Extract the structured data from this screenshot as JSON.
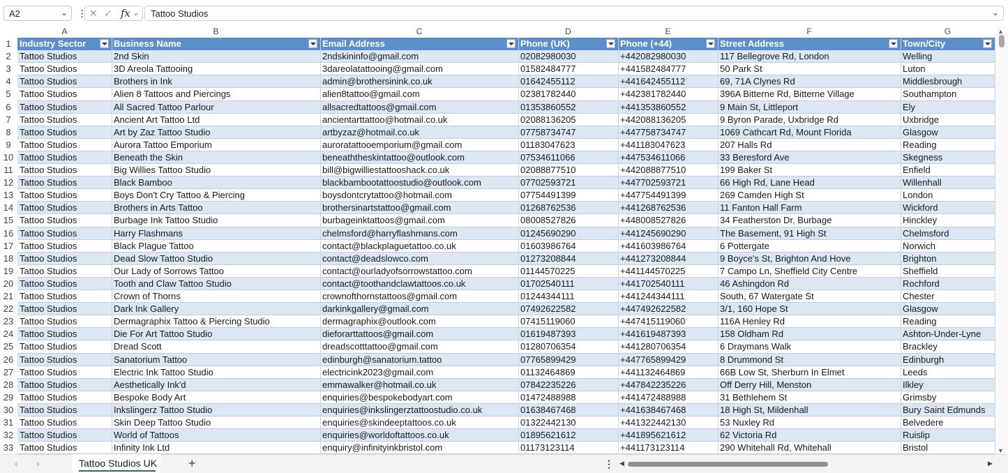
{
  "formula_bar": {
    "name_box": "A2",
    "fx": "fx",
    "content": "Tattoo Studios"
  },
  "columns": [
    "A",
    "B",
    "C",
    "D",
    "E",
    "F",
    "G"
  ],
  "headers": [
    "Industry Sector",
    "Business Name",
    "Email Address",
    "Phone (UK)",
    "Phone (+44)",
    "Street Address",
    "Town/City"
  ],
  "rows": [
    [
      "2",
      "Tattoo Studios",
      "2nd Skin",
      "2ndskininfo@gmail.com",
      "02082980030",
      "+442082980030",
      "117 Bellegrove Rd, London",
      "Welling"
    ],
    [
      "3",
      "Tattoo Studios",
      "3D Areola Tattooing",
      "3dareolatattooing@gmail.com",
      "01582484777",
      "+441582484777",
      "50 Park St",
      "Luton"
    ],
    [
      "4",
      "Tattoo Studios",
      "Brothers in Ink",
      "admin@brothersinink.co.uk",
      "01642455112",
      "+441642455112",
      "69, 71A Clynes Rd",
      "Middlesbrough"
    ],
    [
      "5",
      "Tattoo Studios",
      "Alien 8 Tattoos and Piercings",
      "alien8tattoo@gmail.com",
      "02381782440",
      "+442381782440",
      "396A Bitterne Rd, Bitterne Village",
      "Southampton"
    ],
    [
      "6",
      "Tattoo Studios",
      "All Sacred Tattoo Parlour",
      "allsacredtattoos@gmail.com",
      "01353860552",
      "+441353860552",
      "9 Main St, Littleport",
      "Ely"
    ],
    [
      "7",
      "Tattoo Studios",
      "Ancient Art Tattoo Ltd",
      "ancientarttattoo@hotmail.co.uk",
      "02088136205",
      "+442088136205",
      "9 Byron Parade, Uxbridge Rd",
      "Uxbridge"
    ],
    [
      "8",
      "Tattoo Studios",
      "Art by Zaz Tattoo Studio",
      "artbyzaz@hotmail.co.uk",
      "07758734747",
      "+447758734747",
      "1069 Cathcart Rd, Mount Florida",
      "Glasgow"
    ],
    [
      "9",
      "Tattoo Studios",
      "Aurora Tattoo Emporium",
      "auroratattooemporium@gmail.com",
      "01183047623",
      "+441183047623",
      "207 Halls Rd",
      "Reading"
    ],
    [
      "10",
      "Tattoo Studios",
      "Beneath the Skin",
      "beneaththeskintattoo@outlook.com",
      "07534611066",
      "+447534611066",
      "33 Beresford Ave",
      "Skegness"
    ],
    [
      "11",
      "Tattoo Studios",
      "Big Willies Tattoo Studio",
      "bill@bigwilliestattooshack.co.uk",
      "02088877510",
      "+442088877510",
      "199 Baker St",
      "Enfield"
    ],
    [
      "12",
      "Tattoo Studios",
      "Black Bamboo",
      "blackbambootattoostudio@outlook.com",
      "07702593721",
      "+447702593721",
      "66 High Rd, Lane Head",
      "Willenhall"
    ],
    [
      "13",
      "Tattoo Studios",
      "Boys Don't Cry Tattoo & Piercing",
      "boysdontcrytattoo@hotmail.com",
      "07754491399",
      "+447754491399",
      "269 Camden High St",
      "London"
    ],
    [
      "14",
      "Tattoo Studios",
      "Brothers in Arts Tattoo",
      "brothersinartstattoo@gmail.com",
      "01268762536",
      "+441268762536",
      "11 Fanton Hall Farm",
      "Wickford"
    ],
    [
      "15",
      "Tattoo Studios",
      "Burbage Ink Tattoo Studio",
      "burbageinktattoos@gmail.com",
      "08008527826",
      "+448008527826",
      "34 Featherston Dr, Burbage",
      "Hinckley"
    ],
    [
      "16",
      "Tattoo Studios",
      "Harry Flashmans",
      "chelmsford@harryflashmans.com",
      "01245690290",
      "+441245690290",
      "The Basement, 91 High St",
      "Chelmsford"
    ],
    [
      "17",
      "Tattoo Studios",
      "Black Plague Tattoo",
      "contact@blackplaguetattoo.co.uk",
      "01603986764",
      "+441603986764",
      "6 Pottergate",
      "Norwich"
    ],
    [
      "18",
      "Tattoo Studios",
      "Dead Slow Tattoo Studio",
      "contact@deadslowco.com",
      "01273208844",
      "+441273208844",
      "9 Boyce's St, Brighton And Hove",
      "Brighton"
    ],
    [
      "19",
      "Tattoo Studios",
      "Our Lady of Sorrows Tattoo",
      "contact@ourladyofsorrowstattoo.com",
      "01144570225",
      "+441144570225",
      "7 Campo Ln, Sheffield City Centre",
      "Sheffield"
    ],
    [
      "20",
      "Tattoo Studios",
      "Tooth and Claw Tattoo Studio",
      "contact@toothandclawtattoos.co.uk",
      "01702540111",
      "+441702540111",
      "46 Ashingdon Rd",
      "Rochford"
    ],
    [
      "21",
      "Tattoo Studios",
      "Crown of Thorns",
      "crownofthornstattoos@gmail.com",
      "01244344111",
      "+441244344111",
      "South, 67 Watergate St",
      "Chester"
    ],
    [
      "22",
      "Tattoo Studios",
      "Dark Ink Gallery",
      "darkinkgallery@gmail.com",
      "07492622582",
      "+447492622582",
      "3/1, 160 Hope St",
      "Glasgow"
    ],
    [
      "23",
      "Tattoo Studios",
      "Dermagraphix Tattoo & Piercing Studio",
      "dermagraphix@outlook.com",
      "07415119060",
      "+447415119060",
      "116A Henley Rd",
      "Reading"
    ],
    [
      "24",
      "Tattoo Studios",
      "Die For Art Tattoo Studio",
      "dieforarttattoos@gmail.com",
      "01619487393",
      "+441619487393",
      "158 Oldham Rd",
      "Ashton-Under-Lyne"
    ],
    [
      "25",
      "Tattoo Studios",
      "Dread Scott",
      "dreadscotttattoo@gmail.com",
      "01280706354",
      "+441280706354",
      "6 Draymans Walk",
      "Brackley"
    ],
    [
      "26",
      "Tattoo Studios",
      "Sanatorium Tattoo",
      "edinburgh@sanatorium.tattoo",
      "07765899429",
      "+447765899429",
      "8 Drummond St",
      "Edinburgh"
    ],
    [
      "27",
      "Tattoo Studios",
      "Electric Ink Tattoo Studio",
      "electricink2023@gmail.com",
      "01132464869",
      "+441132464869",
      "66B Low St, Sherburn In Elmet",
      "Leeds"
    ],
    [
      "28",
      "Tattoo Studios",
      "Aesthetically Ink'd",
      "emmawalker@hotmail.co.uk",
      "07842235226",
      "+447842235226",
      "Off Derry Hill, Menston",
      "Ilkley"
    ],
    [
      "29",
      "Tattoo Studios",
      "Bespoke Body Art",
      "enquiries@bespokebodyart.com",
      "01472488988",
      "+441472488988",
      "31 Bethlehem St",
      "Grimsby"
    ],
    [
      "30",
      "Tattoo Studios",
      "Inkslingerz Tattoo Studio",
      "enquiries@inkslingerztattoostudio.co.uk",
      "01638467468",
      "+441638467468",
      "18 High St, Mildenhall",
      "Bury Saint Edmunds"
    ],
    [
      "31",
      "Tattoo Studios",
      "Skin Deep Tattoo Studio",
      "enquiries@skindeeptattoos.co.uk",
      "01322442130",
      "+441322442130",
      "53 Nuxley Rd",
      "Belvedere"
    ],
    [
      "32",
      "Tattoo Studios",
      "World of Tattoos",
      "enquiries@worldoftattoos.co.uk",
      "01895621612",
      "+441895621612",
      "62 Victoria Rd",
      "Ruislip"
    ],
    [
      "33",
      "Tattoo Studios",
      "Infinity Ink Ltd",
      "enquiry@infinityinkbristol.com",
      "01173123114",
      "+441173123114",
      "290 Whitehall Rd, Whitehall",
      "Bristol"
    ]
  ],
  "sheet_tabs": [
    {
      "label": "Tattoo Studios UK",
      "active": true
    }
  ],
  "colors": {
    "header_fill": "#5b8ecb",
    "band_fill": "#dde7f3",
    "active_tab_accent": "#1e7a45"
  },
  "icons": {
    "add_sheet": "plus-icon",
    "prev_sheet": "chevron-left-icon",
    "next_sheet": "chevron-right-icon",
    "cancel": "x-icon",
    "enter": "check-icon"
  }
}
